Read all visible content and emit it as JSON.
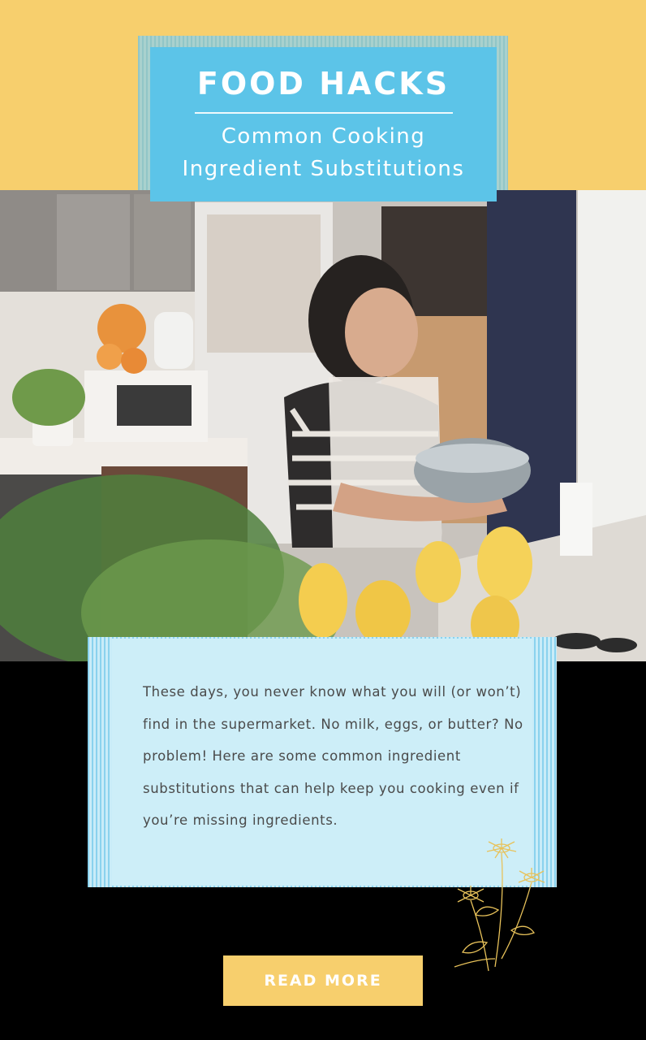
{
  "header": {
    "title": "FOOD HACKS",
    "subtitle_line1": "Common Cooking",
    "subtitle_line2": "Ingredient Substitutions"
  },
  "intro": {
    "text": "These days, you never know what you will (or won’t) find in the supermarket. No milk, eggs, or butter? No problem! Here are some common ingredient substitutions that can help keep you cooking even if you’re missing ingredients."
  },
  "cta": {
    "label": "READ MORE"
  },
  "colors": {
    "header_band": "#f7cf6d",
    "title_box": "#5cc4e8",
    "card": "#cdeef8",
    "cta": "#f7cf6d",
    "background": "#000000",
    "flower_line": "#e8c25a"
  },
  "icons": {
    "flowers": "flower-sketch-icon"
  }
}
